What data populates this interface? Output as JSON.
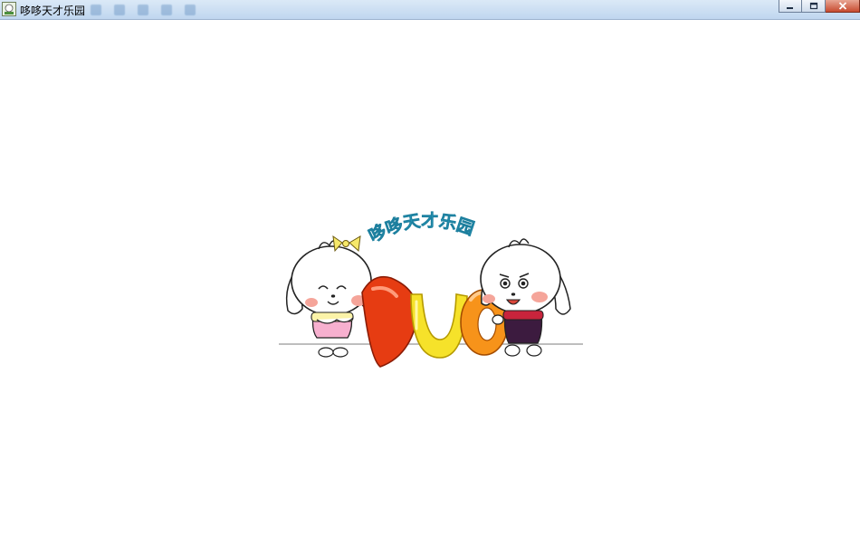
{
  "window": {
    "title": "哆哆天才乐园"
  },
  "logo": {
    "caption": "哆哆天才乐园",
    "letters": [
      "D",
      "U",
      "O"
    ],
    "colors": {
      "d_letter": "#e63c12",
      "u_letter": "#f6e22a",
      "o_letter": "#f7931a",
      "caption": "#33c6e8"
    }
  },
  "icons": {
    "app": "app-icon",
    "minimize": "minimize-icon",
    "maximize": "maximize-icon",
    "close": "close-icon"
  }
}
